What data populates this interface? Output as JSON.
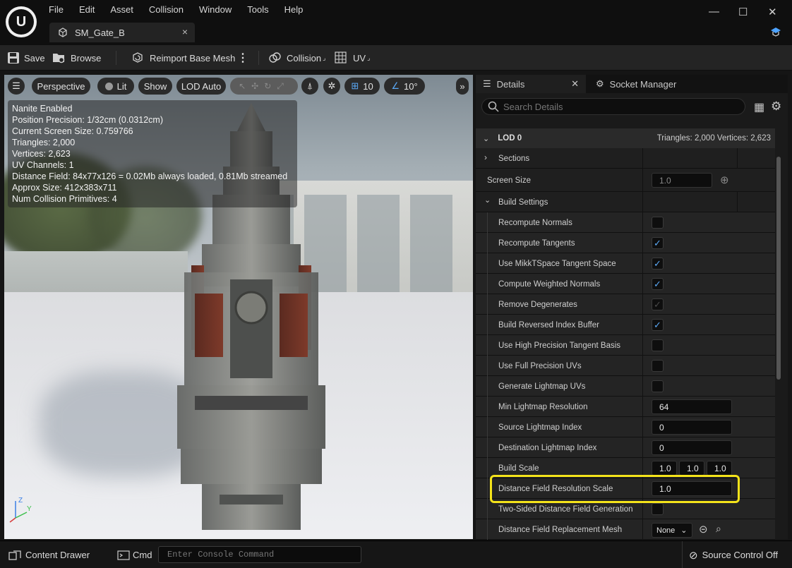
{
  "menu": [
    "File",
    "Edit",
    "Asset",
    "Collision",
    "Window",
    "Tools",
    "Help"
  ],
  "tab": {
    "title": "SM_Gate_B",
    "close": "×"
  },
  "window_controls": {
    "minimize": "—",
    "maximize": "☐",
    "close": "✕"
  },
  "toolbar": {
    "save": "Save",
    "browse": "Browse",
    "reimport": "Reimport Base Mesh",
    "collision": "Collision",
    "uv": "UV"
  },
  "viewport": {
    "perspective": "Perspective",
    "lit": "Lit",
    "show": "Show",
    "lod": "LOD Auto",
    "grid": "10",
    "angle": "10°",
    "stats": [
      "Nanite Enabled",
      "Position Precision: 1/32cm (0.0312cm)",
      "Current Screen Size: 0.759766",
      "Triangles: 2,000",
      "Vertices: 2,623",
      "UV Channels: 1",
      "Distance Field: 84x77x126 = 0.02Mb always loaded, 0.81Mb streamed",
      "Approx Size: 412x383x711",
      "Num Collision Primitives: 4"
    ]
  },
  "panel": {
    "details_tab": "Details",
    "socket_tab": "Socket Manager",
    "search_placeholder": "Search Details",
    "lod_header": "LOD 0",
    "lod_info": "Triangles: 2,000   Vertices: 2,623",
    "sections": "Sections",
    "screen_size_label": "Screen Size",
    "screen_size_value": "1.0",
    "build_settings": "Build Settings",
    "rows": [
      {
        "label": "Recompute Normals",
        "checked": false
      },
      {
        "label": "Recompute Tangents",
        "checked": true
      },
      {
        "label": "Use MikkTSpace Tangent Space",
        "checked": true
      },
      {
        "label": "Compute Weighted Normals",
        "checked": true
      },
      {
        "label": "Remove Degenerates",
        "checked": true,
        "disabled": true
      },
      {
        "label": "Build Reversed Index Buffer",
        "checked": true
      },
      {
        "label": "Use High Precision Tangent Basis",
        "checked": false
      },
      {
        "label": "Use Full Precision UVs",
        "checked": false
      },
      {
        "label": "Generate Lightmap UVs",
        "checked": false
      }
    ],
    "min_lightmap_label": "Min Lightmap Resolution",
    "min_lightmap_value": "64",
    "src_lightmap_label": "Source Lightmap Index",
    "src_lightmap_value": "0",
    "dst_lightmap_label": "Destination Lightmap Index",
    "dst_lightmap_value": "0",
    "build_scale_label": "Build Scale",
    "build_scale_x": "1.0",
    "build_scale_y": "1.0",
    "build_scale_z": "1.0",
    "df_res_label": "Distance Field Resolution Scale",
    "df_res_value": "1.0",
    "two_sided_label": "Two-Sided Distance Field Generation",
    "df_replace_label": "Distance Field Replacement Mesh",
    "df_replace_value": "None"
  },
  "status": {
    "content_drawer": "Content Drawer",
    "cmd": "Cmd",
    "console_placeholder": "Enter Console Command",
    "source_control": "Source Control Off"
  },
  "colors": {
    "accent": "#5aa8f5",
    "highlight": "#f4e31a"
  }
}
